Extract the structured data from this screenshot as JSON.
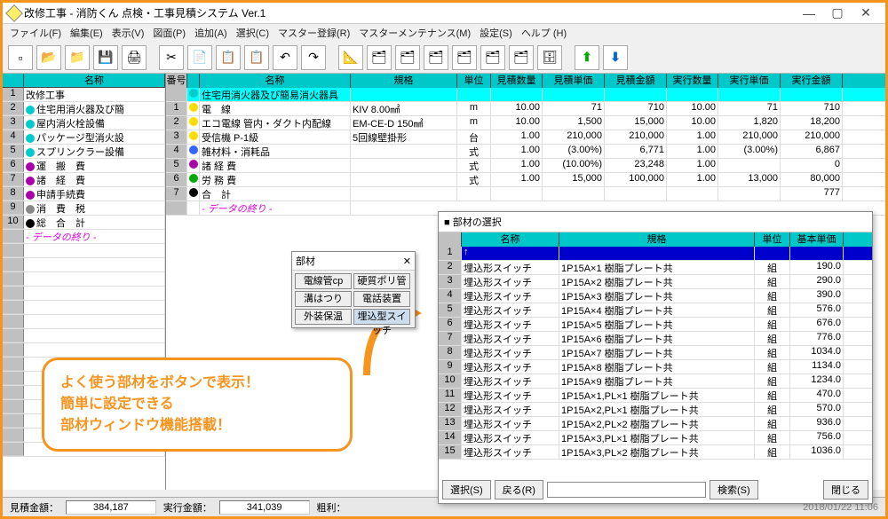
{
  "window": {
    "title": "改修工事 - 消防くん 点検・工事見積システム Ver.1"
  },
  "menu": [
    "ファイル(F)",
    "編集(E)",
    "表示(V)",
    "図面(P)",
    "追加(A)",
    "選択(C)",
    "マスター登録(R)",
    "マスターメンテナンス(M)",
    "設定(S)",
    "ヘルプ (H)"
  ],
  "leftHeader": {
    "name": "名称"
  },
  "leftRows": [
    {
      "n": "1",
      "t": "改修工事"
    },
    {
      "n": "2",
      "d": "d-cyan",
      "t": "住宅用消火器及び簡"
    },
    {
      "n": "3",
      "d": "d-cyan",
      "t": "屋内消火栓設備"
    },
    {
      "n": "4",
      "d": "d-cyan",
      "t": "パッケージ型消火設"
    },
    {
      "n": "5",
      "d": "d-cyan",
      "t": "スプリンクラー設備"
    },
    {
      "n": "6",
      "d": "d-pur",
      "t": "運　搬　費"
    },
    {
      "n": "7",
      "d": "d-pur",
      "t": "諸　経　費"
    },
    {
      "n": "8",
      "d": "d-pur",
      "t": "申請手続費"
    },
    {
      "n": "9",
      "d": "d-gray",
      "t": "消　費　税"
    },
    {
      "n": "10",
      "d": "d-blk",
      "t": "総　合　計"
    }
  ],
  "endText": "- データの終り -",
  "rightHeader": {
    "num": "番号",
    "name": "名称",
    "spec": "規格",
    "unit": "単位",
    "q": "見積数量",
    "up": "見積単価",
    "amt": "見積金額",
    "q2": "実行数量",
    "up2": "実行単価",
    "amt2": "実行金額"
  },
  "rightRows": [
    {
      "n": "",
      "hl": true,
      "d": "d-cyan",
      "name": "住宅用消火器及び簡易消火器具"
    },
    {
      "n": "1",
      "d": "d-yel",
      "name": "電　線",
      "spec": "KIV 8.00㎟",
      "unit": "m",
      "q": "10.00",
      "up": "71",
      "amt": "710",
      "q2": "10.00",
      "up2": "71",
      "amt2": "710"
    },
    {
      "n": "2",
      "d": "d-yel",
      "name": "エコ電線 管内・ダクト内配線",
      "spec": "EM-CE-D 150㎟",
      "unit": "m",
      "q": "10.00",
      "up": "1,500",
      "amt": "15,000",
      "q2": "10.00",
      "up2": "1,820",
      "amt2": "18,200"
    },
    {
      "n": "3",
      "d": "d-yel",
      "name": "受信機 P-1級",
      "spec": "5回線壁掛形",
      "unit": "台",
      "q": "1.00",
      "up": "210,000",
      "amt": "210,000",
      "q2": "1.00",
      "up2": "210,000",
      "amt2": "210,000"
    },
    {
      "n": "4",
      "d": "d-blue",
      "name": "雑材料・消耗品",
      "spec": "",
      "unit": "式",
      "q": "1.00",
      "up": "(3.00%)",
      "amt": "6,771",
      "q2": "1.00",
      "up2": "(3.00%)",
      "amt2": "6,867"
    },
    {
      "n": "5",
      "d": "d-pur",
      "name": "諸 経 費",
      "spec": "",
      "unit": "式",
      "q": "1.00",
      "up": "(10.00%)",
      "amt": "23,248",
      "q2": "1.00",
      "up2": "",
      "amt2": "0"
    },
    {
      "n": "6",
      "d": "d-gre",
      "name": "労 務 費",
      "spec": "",
      "unit": "式",
      "q": "1.00",
      "up": "15,000",
      "amt": "100,000",
      "q2": "1.00",
      "up2": "13,000",
      "amt2": "80,000"
    },
    {
      "n": "7",
      "d": "d-blk",
      "name": "合　計",
      "spec": "",
      "unit": "",
      "q": "",
      "up": "",
      "amt": "",
      "q2": "",
      "up2": "",
      "amt2": "777"
    }
  ],
  "popup1": {
    "title": "部材",
    "btns": [
      "電線管cp",
      "硬質ポリ管",
      "溝はつり",
      "電話装置",
      "外装保温",
      "埋込型スイッチ"
    ]
  },
  "popup2": {
    "title": "部材の選択",
    "head": {
      "name": "名称",
      "spec": "規格",
      "unit": "単位",
      "price": "基本単価"
    },
    "rows": [
      {
        "n": "1",
        "sel": true,
        "name": "↑"
      },
      {
        "n": "2",
        "name": "埋込形スイッチ",
        "spec": "1P15A×1 樹脂プレート共",
        "unit": "組",
        "price": "190.0"
      },
      {
        "n": "3",
        "name": "埋込形スイッチ",
        "spec": "1P15A×2 樹脂プレート共",
        "unit": "組",
        "price": "290.0"
      },
      {
        "n": "4",
        "name": "埋込形スイッチ",
        "spec": "1P15A×3 樹脂プレート共",
        "unit": "組",
        "price": "390.0"
      },
      {
        "n": "5",
        "name": "埋込形スイッチ",
        "spec": "1P15A×4 樹脂プレート共",
        "unit": "組",
        "price": "576.0"
      },
      {
        "n": "6",
        "name": "埋込形スイッチ",
        "spec": "1P15A×5 樹脂プレート共",
        "unit": "組",
        "price": "676.0"
      },
      {
        "n": "7",
        "name": "埋込形スイッチ",
        "spec": "1P15A×6 樹脂プレート共",
        "unit": "組",
        "price": "776.0"
      },
      {
        "n": "8",
        "name": "埋込形スイッチ",
        "spec": "1P15A×7 樹脂プレート共",
        "unit": "組",
        "price": "1034.0"
      },
      {
        "n": "9",
        "name": "埋込形スイッチ",
        "spec": "1P15A×8 樹脂プレート共",
        "unit": "組",
        "price": "1134.0"
      },
      {
        "n": "10",
        "name": "埋込形スイッチ",
        "spec": "1P15A×9 樹脂プレート共",
        "unit": "組",
        "price": "1234.0"
      },
      {
        "n": "11",
        "name": "埋込形スイッチ",
        "spec": "1P15A×1,PL×1 樹脂プレート共",
        "unit": "組",
        "price": "470.0"
      },
      {
        "n": "12",
        "name": "埋込形スイッチ",
        "spec": "1P15A×2,PL×1 樹脂プレート共",
        "unit": "組",
        "price": "570.0"
      },
      {
        "n": "13",
        "name": "埋込形スイッチ",
        "spec": "1P15A×2,PL×2 樹脂プレート共",
        "unit": "組",
        "price": "936.0"
      },
      {
        "n": "14",
        "name": "埋込形スイッチ",
        "spec": "1P15A×3,PL×1 樹脂プレート共",
        "unit": "組",
        "price": "756.0"
      },
      {
        "n": "15",
        "name": "埋込形スイッチ",
        "spec": "1P15A×3,PL×2 樹脂プレート共",
        "unit": "組",
        "price": "1036.0"
      }
    ],
    "btns": {
      "sel": "選択(S)",
      "back": "戻る(R)",
      "search": "検索(S)",
      "close": "閉じる"
    }
  },
  "callout": {
    "l1": "よく使う部材をボタンで表示！",
    "l2": "簡単に設定できる",
    "l3": "部材ウィンドウ機能搭載！"
  },
  "status": {
    "l1": "見積金額：",
    "v1": "384,187",
    "l2": "実行金額：",
    "v2": "341,039",
    "l3": "粗利：",
    "ts": "2018/01/22 11:06"
  }
}
